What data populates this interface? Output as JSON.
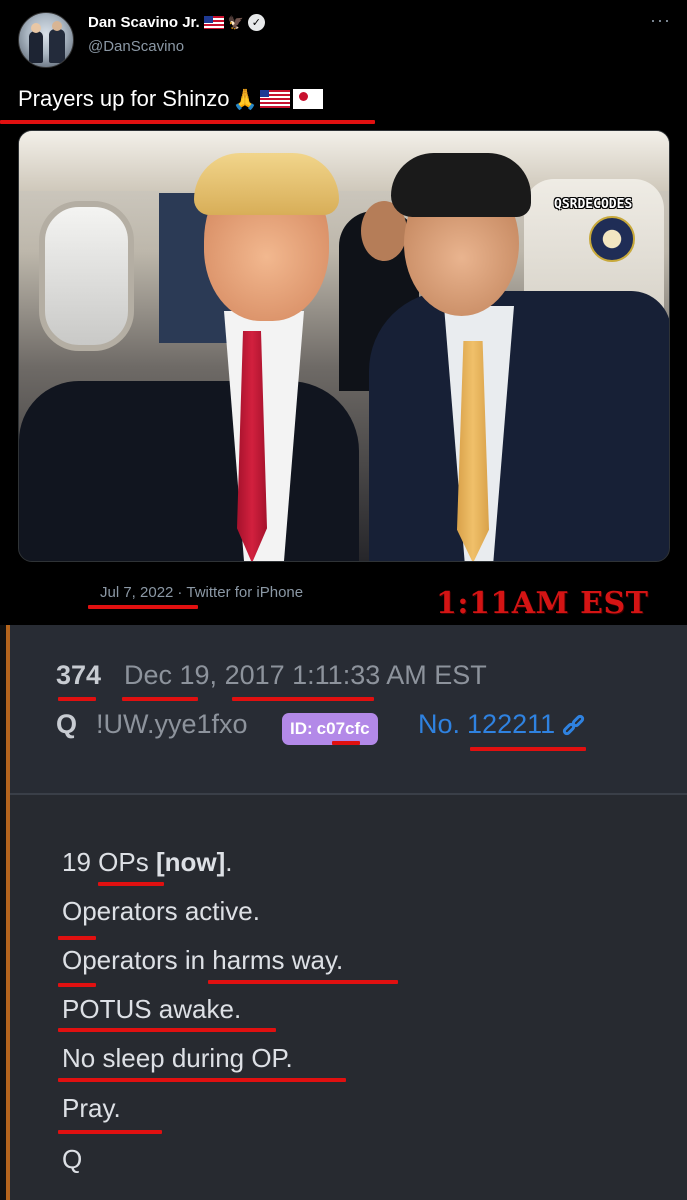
{
  "tweet": {
    "display_name": "Dan Scavino Jr.",
    "handle": "@DanScavino",
    "more_label": "···",
    "text": "Prayers up for Shinzo",
    "photo_watermark": "QSRDECODES",
    "date": "Jul 7, 2022",
    "separator": "·",
    "source": "Twitter for iPhone"
  },
  "overlay": {
    "time_label": "1:11AM EST"
  },
  "qpost": {
    "number": "374",
    "date_part1": "Dec 19, ",
    "date_year": "2017",
    "date_time": " 1:11",
    "date_rest": ":33 AM EST",
    "author": "Q",
    "tripcode": "!UW.yye1fxo",
    "id_label": "ID:",
    "id_value": "c07cfc",
    "no_label": "No.",
    "no_value": "122211",
    "lines": {
      "l1_num": "19 ",
      "l1_ops": "OPs",
      "l1_now": " [now]",
      "l1_end": ".",
      "l2": "Operators active.",
      "l3a": "Operators ",
      "l3b": "in harms way.",
      "l4": "POTUS awake.",
      "l5": "No sleep during OP.",
      "l6": "Pray.",
      "l7": "Q"
    }
  },
  "colors": {
    "underline": "#e11010",
    "accent_red": "#d41414",
    "link_blue": "#2f82e0",
    "id_badge": "#b389e8",
    "post_bar": "#b5651d"
  }
}
